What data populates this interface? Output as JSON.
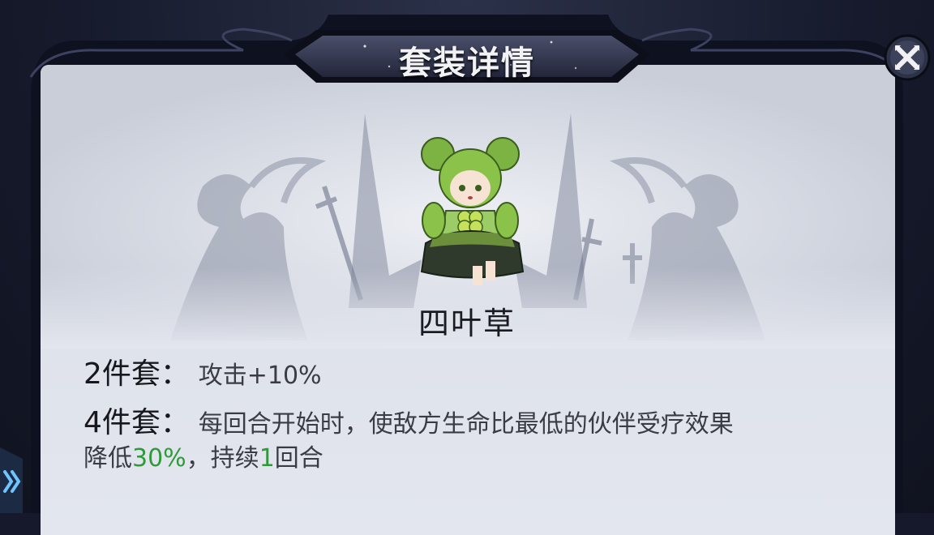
{
  "header": {
    "title": "套装详情"
  },
  "set": {
    "name": "四叶草",
    "bonuses": [
      {
        "label": "2件套",
        "colon": "：",
        "text_before": "攻击",
        "highlight": "+10%"
      },
      {
        "label": "4件套",
        "colon": "：",
        "line1": "每回合开始时，使敌方生命比最低的伙伴受疗效果",
        "line2_a": "降低",
        "line2_value": "30%",
        "line2_b": "，持续",
        "line2_num": "1",
        "line2_c": "回合"
      }
    ]
  },
  "colors": {
    "highlight_green": "#2f9a3a",
    "panel_bg": "#dde1ea",
    "frame_dark": "#0e1120",
    "title_text": "#f2f2f6"
  },
  "icons": {
    "close": "close-x-icon",
    "side_tab": "double-chevron-right-icon",
    "character": "four-leaf-clover-character-icon"
  }
}
